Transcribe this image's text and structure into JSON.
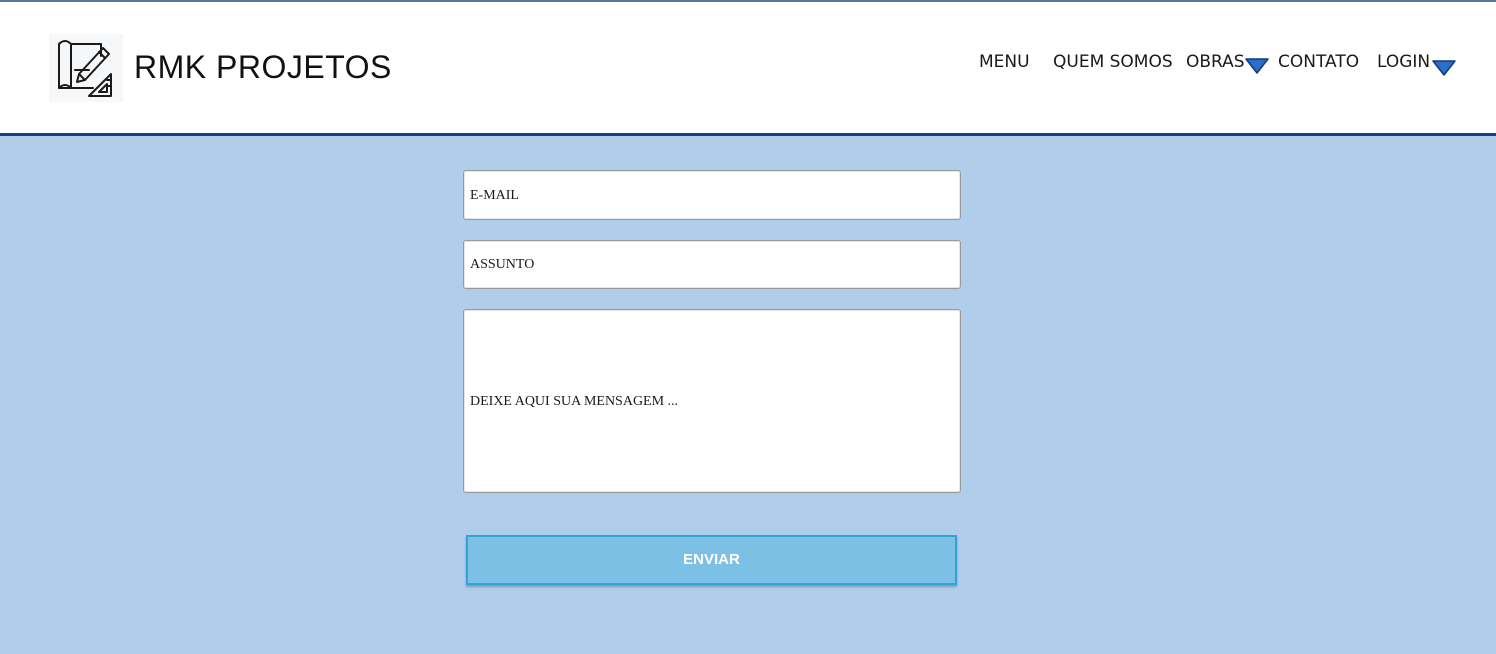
{
  "header": {
    "brand": "RMK PROJETOS",
    "logo_icon": "drafting-blueprint-icon"
  },
  "nav": {
    "items": [
      {
        "label": "MENU"
      },
      {
        "label": "QUEM SOMOS"
      },
      {
        "label": "OBRAS",
        "has_dropdown": true
      },
      {
        "label": "CONTATO"
      },
      {
        "label": "LOGIN",
        "has_dropdown": true
      }
    ],
    "dropdown_icon": "triangle-down-icon",
    "dropdown_color": "#2a6fc9"
  },
  "form": {
    "email_text": "E-MAIL",
    "subject_text": "ASSUNTO",
    "message_text": "DEIXE AQUI SUA MENSAGEM ...",
    "submit_label": "ENVIAR"
  },
  "colors": {
    "background": "#b0cde9",
    "header_border": "#1f3c88",
    "button": "#7dc0e6",
    "button_border": "#2fa4d9"
  }
}
